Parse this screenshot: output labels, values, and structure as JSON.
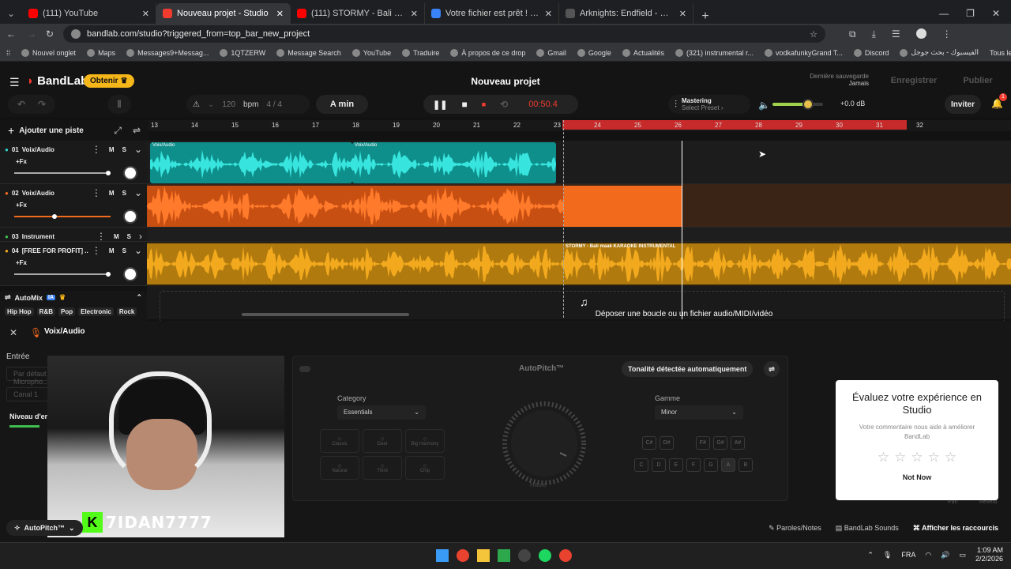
{
  "browser": {
    "tabs": [
      {
        "title": "(111) YouTube",
        "color": "#ff0000",
        "active": false
      },
      {
        "title": "Nouveau projet - Studio",
        "color": "#f23b2f",
        "active": true
      },
      {
        "title": "(111) STORMY - Bali maak KAR",
        "color": "#ff0000",
        "active": false
      },
      {
        "title": "Votre fichier est prêt ! - noTube",
        "color": "#3a82f7",
        "active": false
      },
      {
        "title": "Arknights: Endfield - Over the",
        "color": "#555555",
        "active": false
      }
    ],
    "url": "bandlab.com/studio?triggered_from=top_bar_new_project",
    "bookmarks": [
      "Nouvel onglet",
      "Maps",
      "Messages9+Messag...",
      "1QTZERW",
      "Message Search",
      "YouTube",
      "Traduire",
      "À propos de ce drop",
      "Gmail",
      "Google",
      "Actualités",
      "(321) instrumental r...",
      "vodkafunkyGrand T...",
      "Discord",
      "الفيسبوك - بحث جوجل"
    ],
    "all_tabs": "Tous les favris"
  },
  "app": {
    "brand": "BandLab",
    "obtain": "Obtenir",
    "project_title": "Nouveau projet",
    "last_save_label": "Dernière sauvegarde",
    "last_save_value": "Jamais",
    "save": "Enregistrer",
    "publish": "Publier",
    "tempo": "120",
    "bpm": "bpm",
    "time_sig": "4 / 4",
    "key": "A min",
    "timecode": "00:50.4",
    "mastering": "Mastering",
    "select_preset": "Select Preset",
    "volume_db": "+0.0 dB",
    "invite": "Inviter",
    "notif_count": "1",
    "add_track": "Ajouter une piste",
    "accent": "#f23b2f"
  },
  "ruler": [
    "13",
    "14",
    "15",
    "16",
    "17",
    "18",
    "19",
    "20",
    "21",
    "22",
    "23",
    "24",
    "25",
    "26",
    "27",
    "28",
    "29",
    "30",
    "31",
    "32"
  ],
  "tracks": [
    {
      "num": "01",
      "name": "Voix/Audio",
      "fx": "+Fx",
      "color": "#2fd3c8",
      "clips": [
        "Voix/Audio",
        "Voix/Audio"
      ]
    },
    {
      "num": "02",
      "name": "Voix/Audio",
      "fx": "+Fx",
      "color": "#f26b1d",
      "clips": []
    },
    {
      "num": "03",
      "name": "Instrument",
      "fx": "",
      "color": "#3fbf4f",
      "clips": []
    },
    {
      "num": "04",
      "name": "[FREE FOR PROFIT] ...",
      "fx": "+Fx",
      "color": "#f2a91d",
      "clips": [
        "STORMY - Bali maak KARAOKE INSTRUMENTAL"
      ]
    }
  ],
  "ms": {
    "m": "M",
    "s": "S"
  },
  "automix": {
    "label": "AutoMix",
    "ia": "IA",
    "genres": [
      "Hip Hop",
      "R&B",
      "Pop",
      "Electronic",
      "Rock"
    ]
  },
  "drop_hint": "Déposer une boucle ou un fichier audio/MIDI/vidéo",
  "lower": {
    "track_title": "Voix/Audio",
    "entree": "Entrée",
    "input_device": "Par défaut - Micropho...",
    "channel": "Canal 1",
    "level": "Niveau d'entrée",
    "autopitch": "AutoPitch™",
    "detect": "Tonalité détectée automatiquement",
    "category_label": "Category",
    "category_value": "Essentials",
    "categories": [
      "Classic",
      "Duet",
      "Big Harmony",
      "Natural",
      "Third",
      "Chip"
    ],
    "gamme_label": "Gamme",
    "gamme_value": "Minor",
    "sharps": [
      "C#",
      "D#",
      "F#",
      "G#",
      "A#"
    ],
    "notes": [
      "C",
      "D",
      "E",
      "F",
      "G",
      "A",
      "B"
    ],
    "knob_label": "Haute",
    "pan": "Pan",
    "reverb": "Reverb",
    "footer_autopitch": "AutoPitch™",
    "lyrics": "Paroles/Notes",
    "sounds": "BandLab Sounds",
    "shortcuts": "Afficher les raccourcis"
  },
  "overlay_name": "7IDAN7777",
  "modal": {
    "title": "Évaluez votre expérience en Studio",
    "subtitle": "Votre commentaire nous aide à améliorer BandLab",
    "stars": 5,
    "not_now": "Not Now"
  },
  "taskbar": {
    "lang": "FRA",
    "time": "1:09 AM",
    "date": "2/2/2026"
  }
}
